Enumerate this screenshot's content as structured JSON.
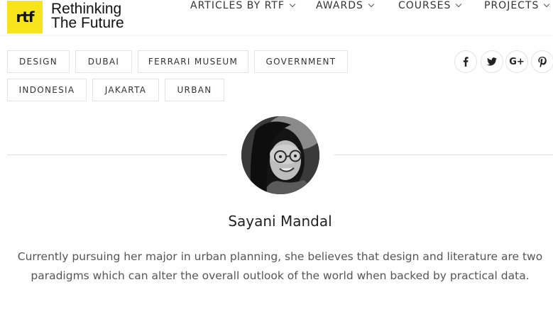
{
  "header": {
    "logo_text": "rtf",
    "brand_line1": "Rethinking",
    "brand_line2": "The Future",
    "logo_color": "#f7e41a",
    "nav": [
      {
        "label": "ARTICLES BY RTF"
      },
      {
        "label": "AWARDS"
      },
      {
        "label": "COURSES"
      },
      {
        "label": "PROJECTS"
      }
    ]
  },
  "tags": [
    "DESIGN",
    "DUBAI",
    "FERRARI MUSEUM",
    "GOVERNMENT",
    "INDONESIA",
    "JAKARTA",
    "URBAN"
  ],
  "social": {
    "icons": [
      "facebook-icon",
      "twitter-icon",
      "google-plus-icon",
      "pinterest-icon"
    ],
    "gplus_label": "G+"
  },
  "author": {
    "name": "Sayani Mandal",
    "bio": "Currently pursuing her major in urban planning, she believes that design and literature are two paradigms which can alter the overall outlook of the world when backed by practical data."
  }
}
